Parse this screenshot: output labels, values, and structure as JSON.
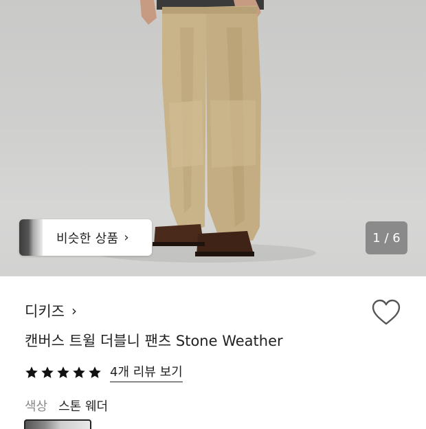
{
  "product_image": {
    "alt": "캔버스 트윌 더블니 팬츠 Stone Weather",
    "pager": "1 / 6"
  },
  "similar": {
    "label": "비슷한 상품",
    "chevron": "›"
  },
  "brand": {
    "name": "디키즈",
    "chevron": "›"
  },
  "title": "캔버스 트윌 더블니 팬츠 Stone Weather",
  "rating": {
    "stars": 5,
    "max": 5,
    "reviews_label": "4개 리뷰 보기"
  },
  "color": {
    "label": "색상",
    "value": "스톤 웨더"
  },
  "icons": {
    "wishlist": "heart-outline-icon",
    "star": "star-filled-icon"
  },
  "colors": {
    "text": "#222222",
    "muted": "#888888",
    "pager_bg": "#6e6e6e",
    "pants": "#c9b389"
  }
}
